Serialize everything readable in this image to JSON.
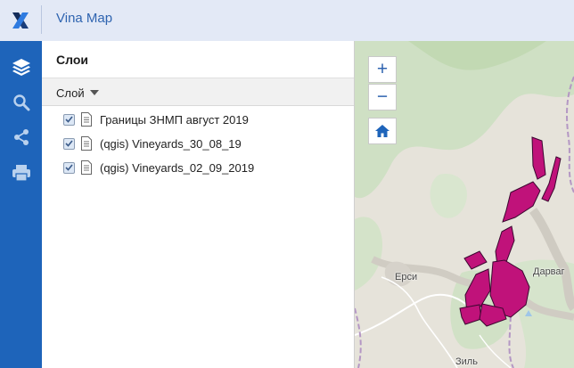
{
  "header": {
    "app_title": "Vina Map",
    "logo_icon": "x-logo-icon",
    "background": "#e3e9f6",
    "title_color": "#2f64b0"
  },
  "rail": {
    "background": "#1e64ba",
    "buttons": [
      {
        "icon": "layers-icon"
      },
      {
        "icon": "search-icon"
      },
      {
        "icon": "share-icon"
      },
      {
        "icon": "print-icon"
      }
    ]
  },
  "panel": {
    "title": "Слои",
    "toolbar": {
      "dropdown_label": "Слой"
    },
    "layers": [
      {
        "label": "Границы ЗНМП август 2019",
        "checked": true
      },
      {
        "label": "(qgis) Vineyards_30_08_19",
        "checked": true
      },
      {
        "label": "(qgis) Vineyards_02_09_2019",
        "checked": true
      }
    ]
  },
  "map": {
    "controls": {
      "zoom_in": "+",
      "zoom_out": "−",
      "home_icon": "home-icon"
    },
    "places": [
      "Ерси",
      "Дарваг",
      "Зиль"
    ],
    "polygon_color": "#c0127a"
  }
}
